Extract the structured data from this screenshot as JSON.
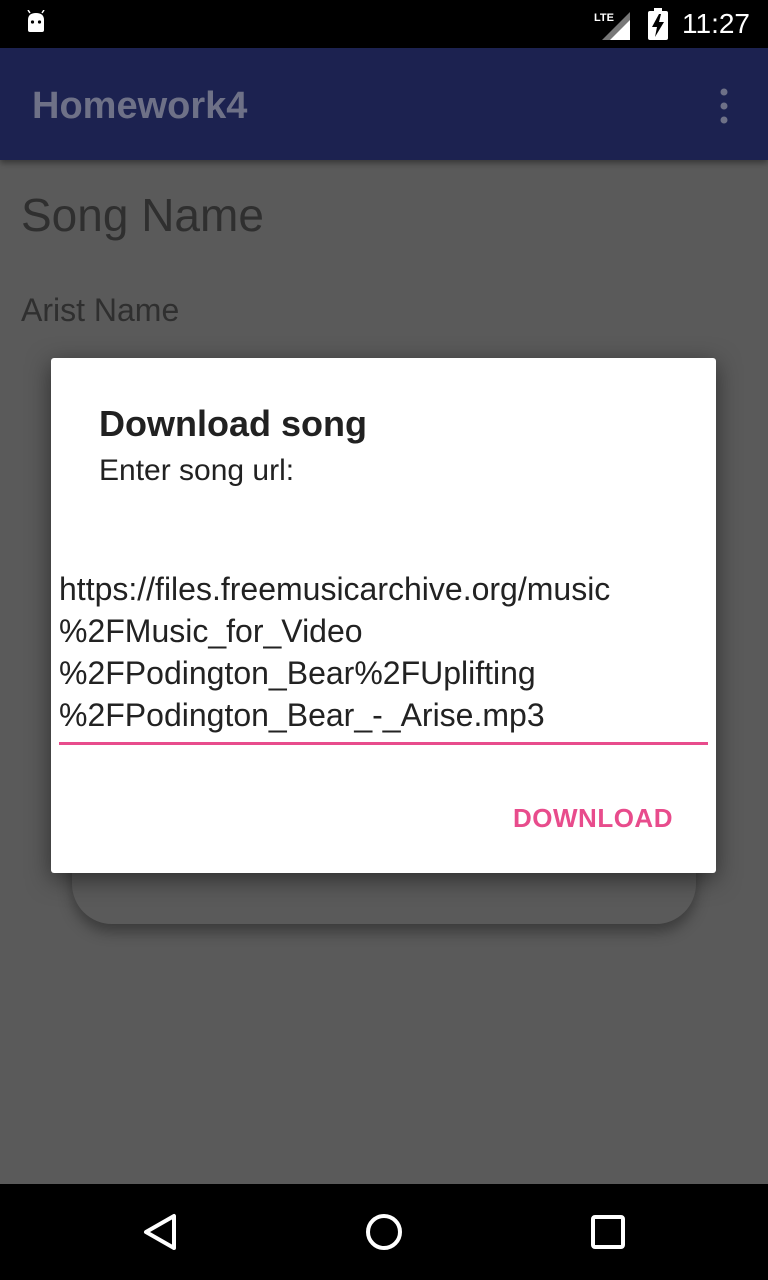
{
  "status_bar": {
    "time": "11:27",
    "network_label": "LTE",
    "icons": [
      "android-icon",
      "lte-signal-icon",
      "battery-charging-icon"
    ]
  },
  "app_bar": {
    "title": "Homework4",
    "overflow_icon": "more-vert-icon"
  },
  "content": {
    "song_name": "Song Name",
    "artist_name": "Arist Name"
  },
  "dialog": {
    "title": "Download song",
    "message": "Enter song url:",
    "input": {
      "lines": [
        "https://files.freemusicarchive.org/music",
        "%2FMusic_for_Video",
        "%2FPodington_Bear%2FUplifting",
        "%2FPodington_Bear_-_Arise.mp3"
      ]
    },
    "download_label": "DOWNLOAD"
  },
  "nav_bar": {
    "icons": [
      "back-icon",
      "home-icon",
      "recents-icon"
    ]
  },
  "colors": {
    "app_bar": "#1c2250",
    "accent": "#e84c8c",
    "scrim_background": "#5a5a5a"
  }
}
